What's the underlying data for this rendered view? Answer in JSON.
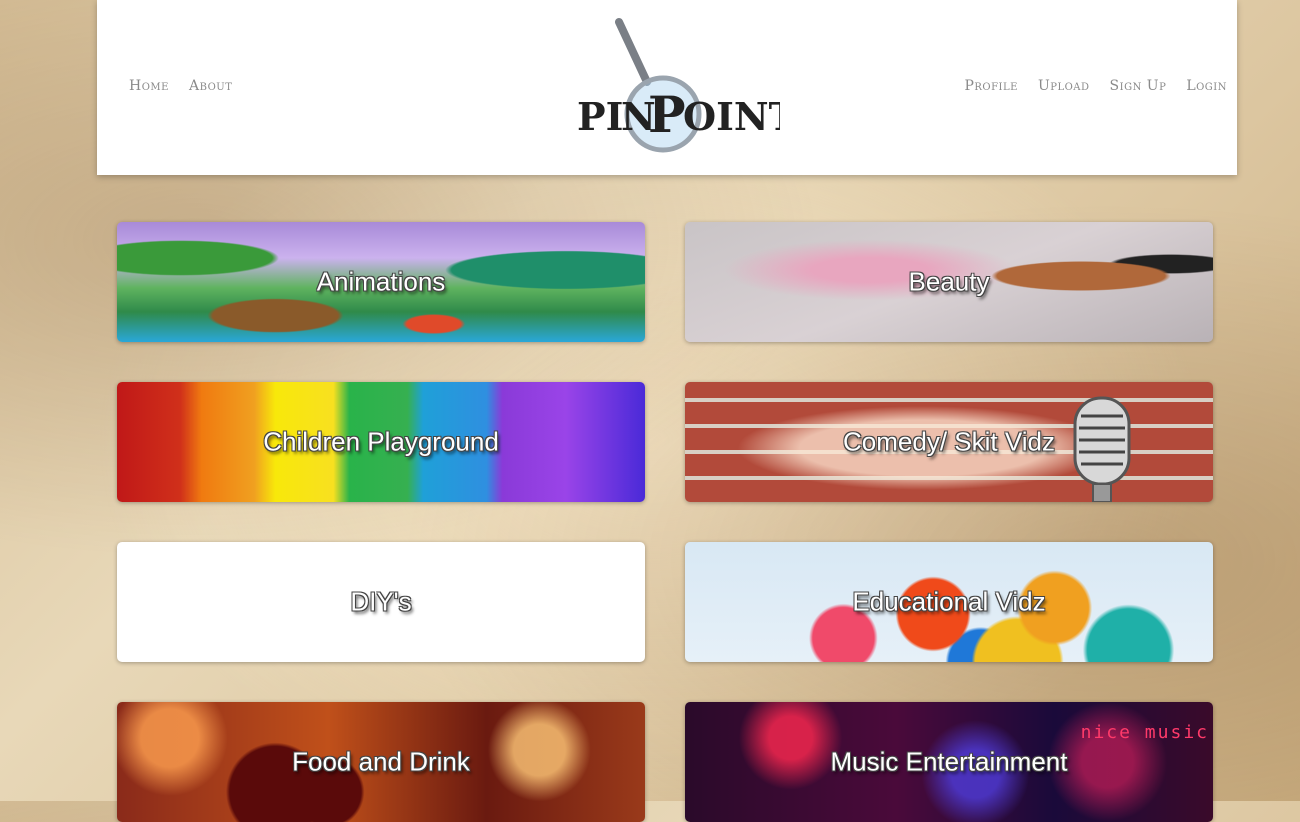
{
  "header": {
    "nav_left": [
      "Home",
      "About"
    ],
    "nav_right": [
      "Profile",
      "Upload",
      "Sign Up",
      "Login"
    ],
    "logo_text": "PINPOINT"
  },
  "categories": [
    {
      "label": "Animations",
      "bg": "animations"
    },
    {
      "label": "Beauty",
      "bg": "beauty"
    },
    {
      "label": "Children Playground",
      "bg": "children"
    },
    {
      "label": "Comedy/ Skit Vidz",
      "bg": "comedy"
    },
    {
      "label": "DIY's",
      "bg": "diy"
    },
    {
      "label": "Educational Vidz",
      "bg": "edu"
    },
    {
      "label": "Food and Drink",
      "bg": "food"
    },
    {
      "label": "Music Entertainment",
      "bg": "music"
    }
  ],
  "music_tile_text": "nice music",
  "colors": {
    "nav_link": "#8a8a8a",
    "header_bg": "#ffffff"
  }
}
